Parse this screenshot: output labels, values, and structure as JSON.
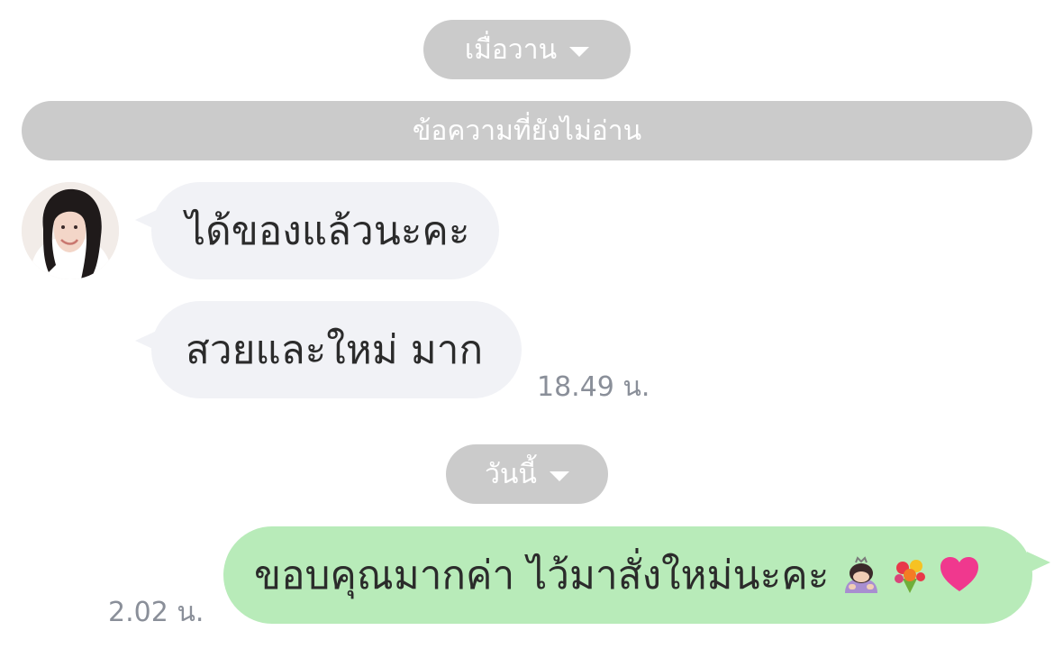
{
  "chat": {
    "date_yesterday": "เมื่อวาน",
    "unread_divider": "ข้อความที่ยังไม่อ่าน",
    "incoming_messages": [
      {
        "text": "ได้ของแล้วนะคะ"
      },
      {
        "text": "สวยและใหม่ มาก",
        "time": "18.49 น."
      }
    ],
    "date_today": "วันนี้",
    "outgoing_message": {
      "text": "ขอบคุณมากค่า ไว้มาสั่งใหม่นะคะ",
      "emoji": [
        "person-bowing-emoji",
        "bouquet-emoji",
        "growing-heart-emoji"
      ],
      "time": "2.02 น."
    }
  },
  "colors": {
    "date_pill": "#cbcbcb",
    "incoming_bubble": "#f1f2f6",
    "outgoing_bubble": "#b8ebb9",
    "timestamp": "#8a8f99",
    "heart": "#f0388e"
  }
}
